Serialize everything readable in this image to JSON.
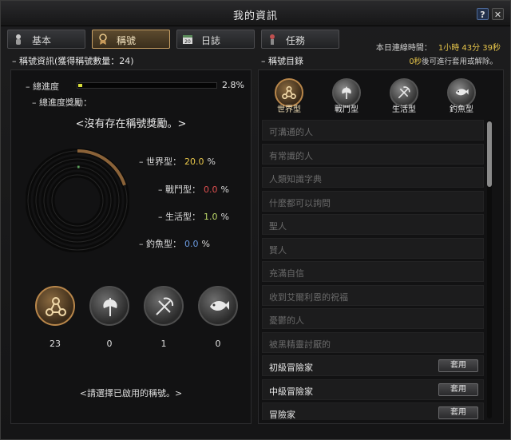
{
  "window": {
    "title": "我的資訊"
  },
  "titlebar": {
    "help": "?",
    "close": "✕"
  },
  "tabs": [
    {
      "label": "基本",
      "icon": "person-icon"
    },
    {
      "label": "稱號",
      "icon": "medal-icon",
      "active": true
    },
    {
      "label": "日誌",
      "icon": "calendar-icon",
      "icon_text": "20"
    },
    {
      "label": "任務",
      "icon": "quest-icon"
    }
  ],
  "connection": {
    "label": "本日連線時間：",
    "value": "1小時 43分 39秒"
  },
  "left": {
    "header": "稱號資訊(獲得稱號數量：24)",
    "progress": {
      "label": "總進度",
      "value": "2.8%",
      "fraction": 0.028
    },
    "reward_label": "總進度獎勵：",
    "reward_message": "<沒有存在稱號獎勵。>",
    "stats": [
      {
        "label": "世界型：",
        "value": "20.0",
        "unit": "%",
        "color": "#e8c64a",
        "fraction": 0.2
      },
      {
        "label": "戰鬥型：",
        "value": "0.0",
        "unit": "%",
        "color": "#e05050",
        "fraction": 0.0
      },
      {
        "label": "生活型：",
        "value": "1.0",
        "unit": "%",
        "color": "#bcd86a",
        "fraction": 0.01
      },
      {
        "label": "釣魚型：",
        "value": "0.0",
        "unit": "%",
        "color": "#6a9ae0",
        "fraction": 0.0
      }
    ],
    "type_counts": [
      {
        "icon": "world-type-icon",
        "count": "23"
      },
      {
        "icon": "combat-type-icon",
        "count": "0"
      },
      {
        "icon": "life-type-icon",
        "count": "1"
      },
      {
        "icon": "fishing-type-icon",
        "count": "0"
      }
    ],
    "select_message": "<請選擇已啟用的稱號。>"
  },
  "right": {
    "header": "稱號目錄",
    "hint_prefix": "0秒",
    "hint_suffix": "後可進行套用或解除。",
    "categories": [
      {
        "label": "世界型",
        "icon": "world-type-icon",
        "selected": true
      },
      {
        "label": "戰鬥型",
        "icon": "combat-type-icon"
      },
      {
        "label": "生活型",
        "icon": "life-type-icon"
      },
      {
        "label": "釣魚型",
        "icon": "fishing-type-icon"
      }
    ],
    "apply_label": "套用",
    "titles": [
      {
        "name": "可溝通的人",
        "owned": false
      },
      {
        "name": "有常識的人",
        "owned": false
      },
      {
        "name": "人類知識字典",
        "owned": false
      },
      {
        "name": "什麼都可以詢問",
        "owned": false
      },
      {
        "name": "聖人",
        "owned": false
      },
      {
        "name": "賢人",
        "owned": false
      },
      {
        "name": "充滿自信",
        "owned": false
      },
      {
        "name": "收到艾爾利恩的祝福",
        "owned": false
      },
      {
        "name": "憂鬱的人",
        "owned": false
      },
      {
        "name": "被黑精靈討厭的",
        "owned": false
      },
      {
        "name": "初級冒險家",
        "owned": true
      },
      {
        "name": "中級冒險家",
        "owned": true
      },
      {
        "name": "冒險家",
        "owned": true
      }
    ]
  }
}
